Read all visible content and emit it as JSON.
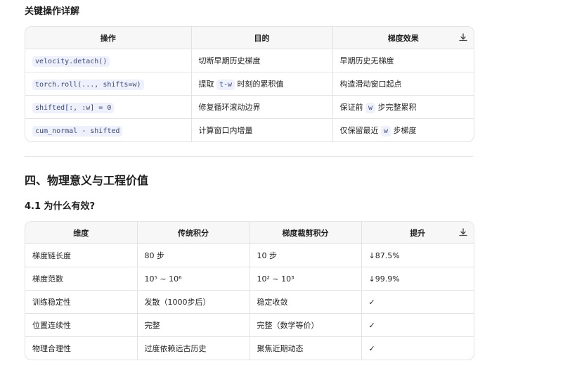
{
  "section1": {
    "heading": "关键操作详解",
    "headers": [
      "操作",
      "目的",
      "梯度效果"
    ],
    "rows": [
      {
        "op": "velocity.detach()",
        "purpose": "切断早期历史梯度",
        "effect": "早期历史无梯度"
      },
      {
        "op": "torch.roll(..., shifts=w)",
        "purpose_pre": "提取 ",
        "purpose_code": "t-w",
        "purpose_post": " 时刻的累积值",
        "effect": "构造滑动窗口起点"
      },
      {
        "op": "shifted[:, :w] = 0",
        "purpose": "修复循环滚动边界",
        "effect_pre": "保证前 ",
        "effect_code": "w",
        "effect_post": " 步完整累积"
      },
      {
        "op": "cum_normal - shifted",
        "purpose": "计算窗口内增量",
        "effect_pre": "仅保留最近 ",
        "effect_code": "w",
        "effect_post": " 步梯度"
      }
    ]
  },
  "section2": {
    "heading": "四、物理意义与工程价值",
    "subheading": "4.1 为什么有效?",
    "headers": [
      "维度",
      "传统积分",
      "梯度裁剪积分",
      "提升"
    ],
    "rows": [
      [
        "梯度链长度",
        "80 步",
        "10 步",
        "↓87.5%"
      ],
      [
        "梯度范数",
        "10⁵ ~ 10⁶",
        "10² ~ 10³",
        "↓99.9%"
      ],
      [
        "训练稳定性",
        "发散（1000步后）",
        "稳定收敛",
        "✓"
      ],
      [
        "位置连续性",
        "完整",
        "完整（数学等价）",
        "✓"
      ],
      [
        "物理合理性",
        "过度依赖远古历史",
        "聚焦近期动态",
        "✓"
      ]
    ]
  },
  "icons": {
    "download": "download-icon"
  }
}
